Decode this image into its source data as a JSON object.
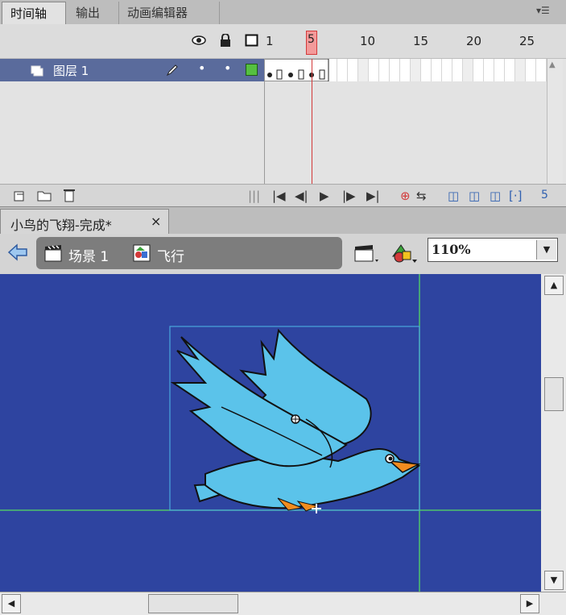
{
  "panel_tabs": [
    "时间轴",
    "输出",
    "动画编辑器"
  ],
  "timeline": {
    "header_icons": [
      "eye-icon",
      "lock-icon",
      "outline-icon"
    ],
    "frame_numbers": [
      "1",
      "5",
      "10",
      "15",
      "20",
      "25"
    ],
    "current_frame": "5",
    "layer_name": "图层 1",
    "footer_frame": "5"
  },
  "document": {
    "tab_title": "小鸟的飞翔-完成*",
    "close_glyph": "×"
  },
  "editbar": {
    "scene_label": "场景 1",
    "symbol_label": "飞行",
    "zoom_value": "110%"
  },
  "colors": {
    "stage_bg": "#2e44a0",
    "layer_highlight": "#5a6b9c",
    "playhead": "#d33a3a",
    "bird": "#5bc3ea",
    "beak": "#f28c1f"
  }
}
